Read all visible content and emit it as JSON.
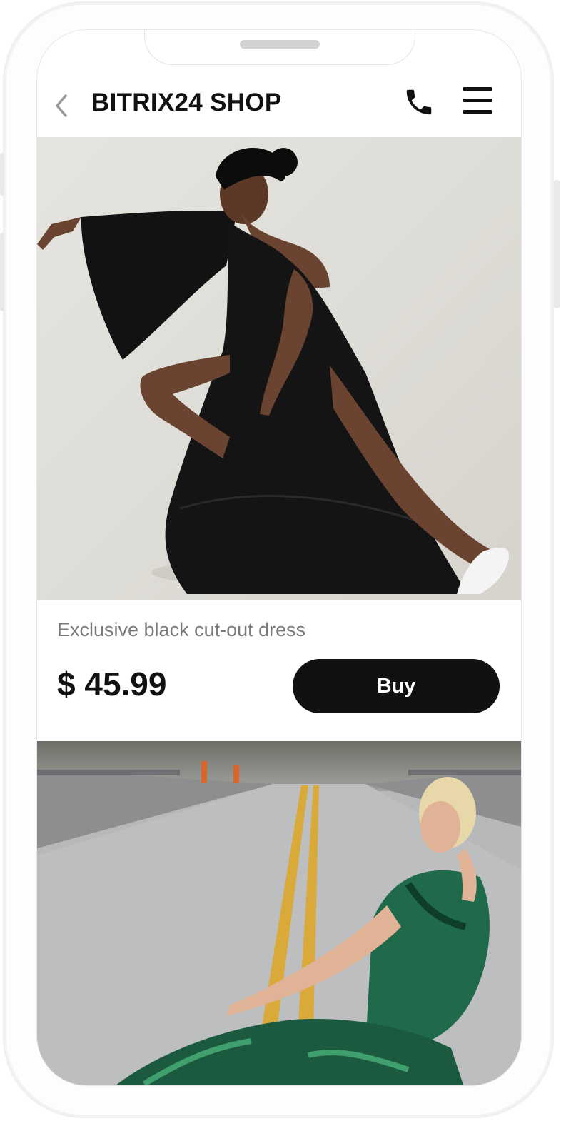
{
  "header": {
    "title": "BITRIX24 SHOP",
    "back_icon": "chevron-left-icon",
    "call_icon": "phone-icon",
    "menu_icon": "hamburger-menu-icon"
  },
  "products": [
    {
      "name": "Exclusive black cut-out dress",
      "price": "$ 45.99",
      "buy_label": "Buy"
    }
  ],
  "colors": {
    "accent": "#111111",
    "background": "#ffffff",
    "secondary_text": "#7a7a7a"
  }
}
